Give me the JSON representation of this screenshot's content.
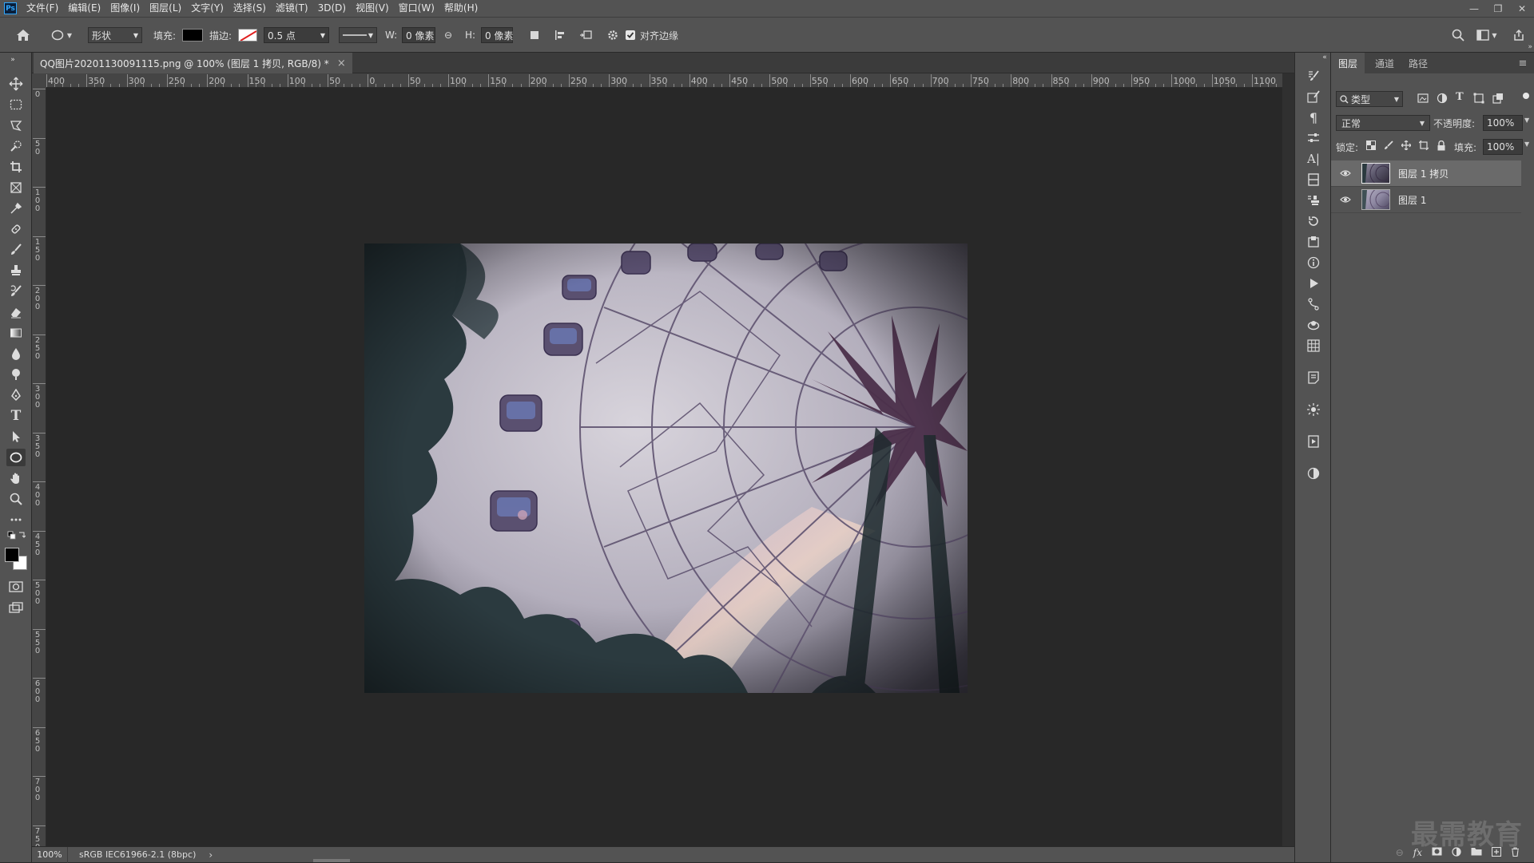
{
  "app": {
    "logo_text": "Ps"
  },
  "menu": [
    "文件(F)",
    "编辑(E)",
    "图像(I)",
    "图层(L)",
    "文字(Y)",
    "选择(S)",
    "滤镜(T)",
    "3D(D)",
    "视图(V)",
    "窗口(W)",
    "帮助(H)"
  ],
  "window_controls": {
    "minimize": "—",
    "restore": "❐",
    "close": "✕"
  },
  "options": {
    "mode_value": "形状",
    "fill_label": "填充:",
    "stroke_label": "描边:",
    "stroke_width": "0.5 点",
    "w_label": "W:",
    "w_value": "0 像素",
    "link_icon": "⊖",
    "h_label": "H:",
    "h_value": "0 像素",
    "align_edges_label": "对齐边缘",
    "colors": {
      "fill": "#000000",
      "stroke": "#ffffff"
    }
  },
  "document": {
    "tab_title": "QQ图片20201130091115.png @ 100% (图层 1 拷贝, RGB/8) *",
    "close": "×"
  },
  "ruler": {
    "h_labels": [
      "400",
      "350",
      "300",
      "250",
      "200",
      "150",
      "100",
      "50",
      "0",
      "50",
      "100",
      "150",
      "200",
      "250",
      "300",
      "350",
      "400",
      "450",
      "500",
      "550",
      "600",
      "650",
      "700",
      "750",
      "800",
      "850",
      "900",
      "950",
      "1000",
      "1050",
      "1100"
    ],
    "v_labels": [
      "0",
      "50",
      "100",
      "150",
      "200",
      "250",
      "300",
      "350",
      "400",
      "450",
      "500",
      "550",
      "600",
      "650",
      "700",
      "750"
    ]
  },
  "status": {
    "zoom": "100%",
    "profile": "sRGB IEC61966-2.1 (8bpc)",
    "arrow": "›"
  },
  "layers_panel": {
    "tabs": [
      "图层",
      "通道",
      "路径"
    ],
    "filter_kind": "类型",
    "blend_mode": "正常",
    "opacity_label": "不透明度:",
    "opacity_value": "100%",
    "lock_label": "锁定:",
    "fill_label": "填充:",
    "fill_value": "100%",
    "layers": [
      {
        "name": "图层 1 拷贝",
        "selected": true
      },
      {
        "name": "图层 1",
        "selected": false
      }
    ]
  },
  "watermark": "最需教育"
}
